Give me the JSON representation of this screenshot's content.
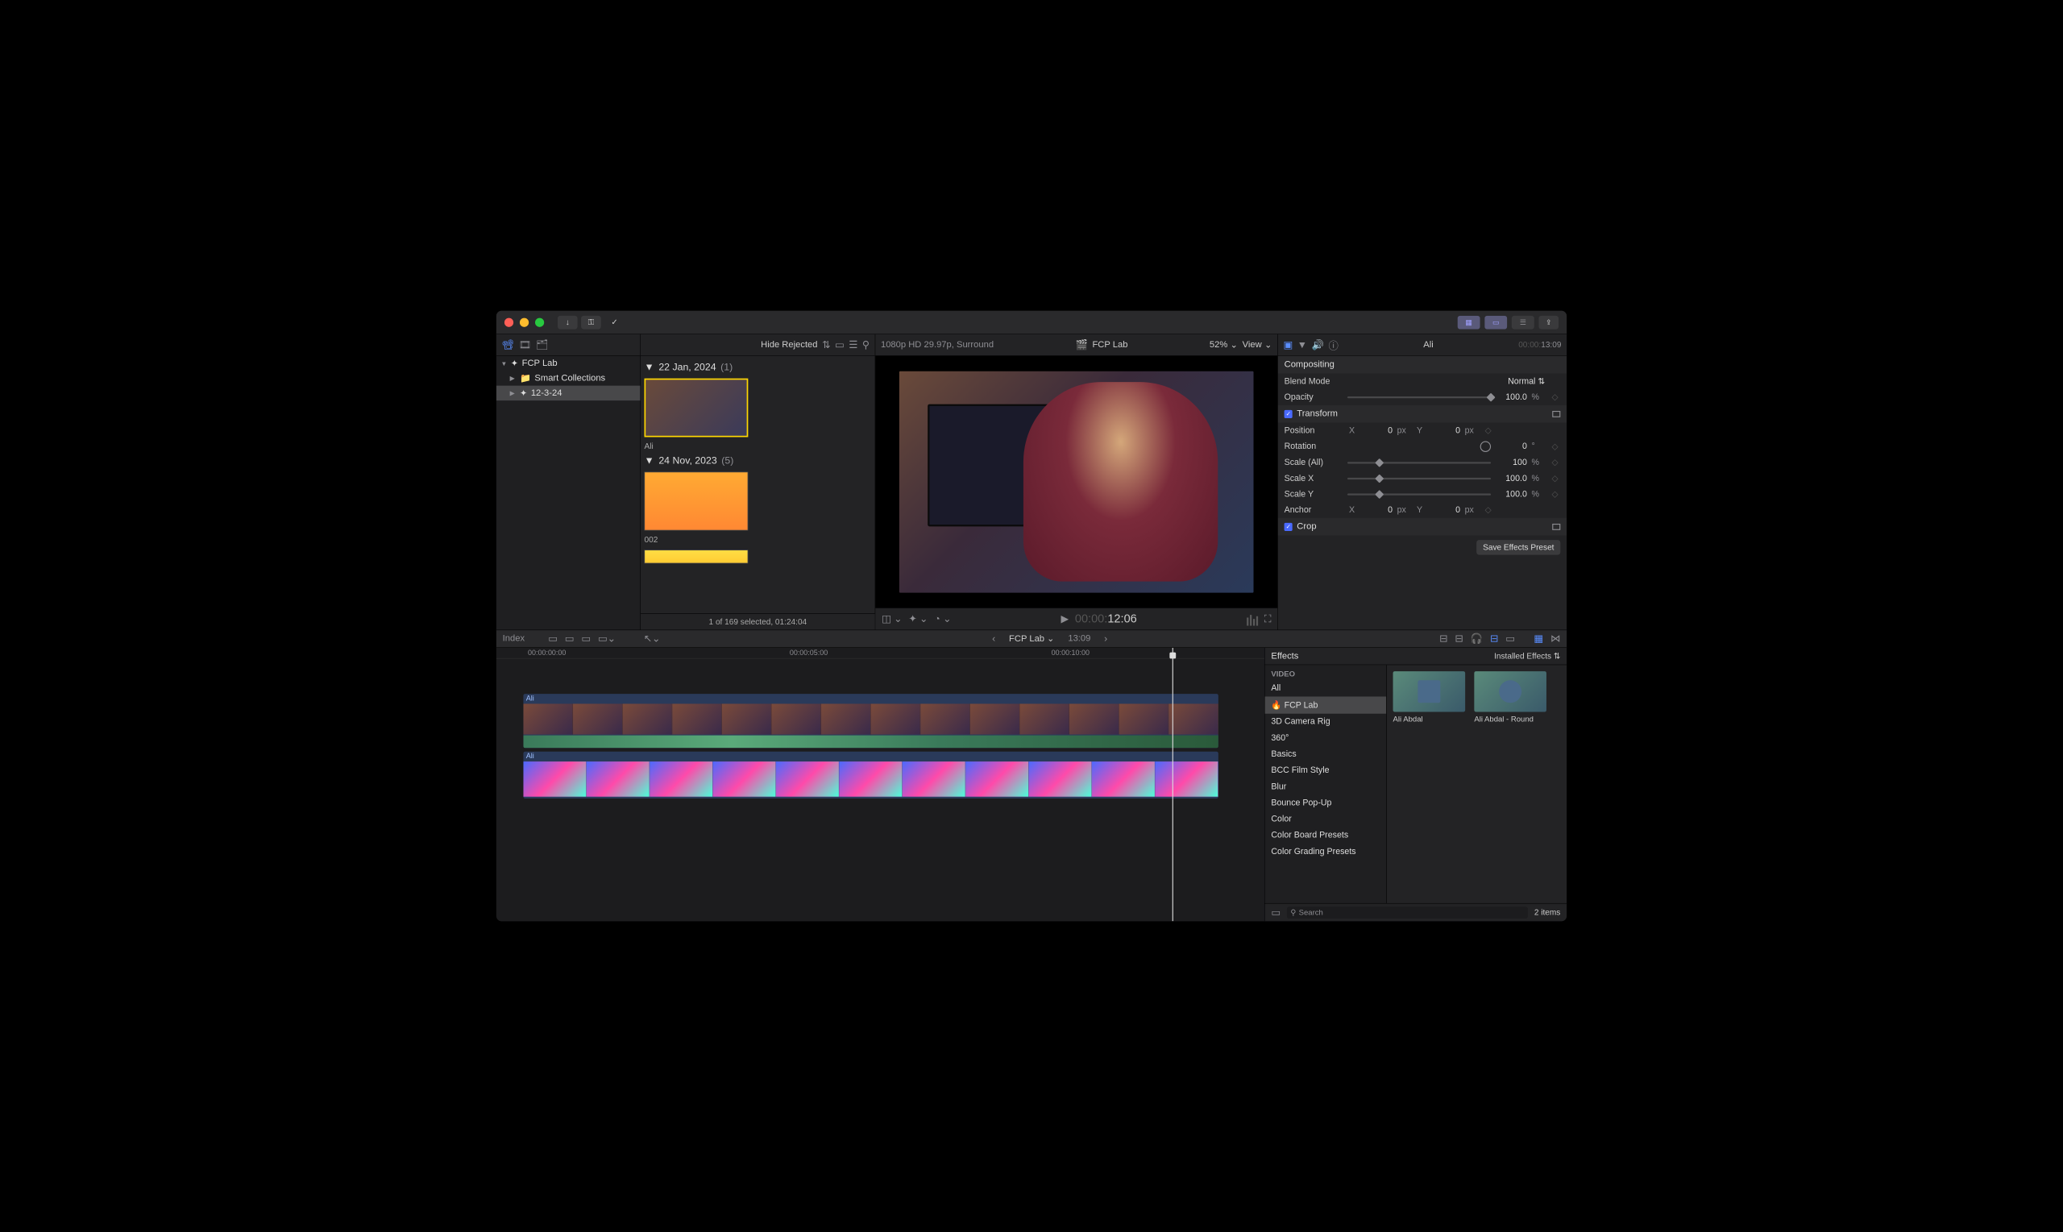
{
  "titlebar": {},
  "toolbar": {
    "hide_rejected": "Hide Rejected",
    "viewer_format": "1080p HD 29.97p, Surround",
    "project_name": "FCP Lab",
    "zoom": "52%",
    "view": "View"
  },
  "sidebar": {
    "library": "FCP Lab",
    "items": [
      {
        "label": "Smart Collections"
      },
      {
        "label": "12-3-24"
      }
    ]
  },
  "browser": {
    "events": [
      {
        "date": "22 Jan, 2024",
        "count": "(1)",
        "clips": [
          {
            "name": "Ali"
          }
        ]
      },
      {
        "date": "24 Nov, 2023",
        "count": "(5)",
        "clips": [
          {
            "name": "002"
          }
        ]
      }
    ],
    "footer": "1 of 169 selected, 01:24:04"
  },
  "viewer": {
    "timecode_dim": "00:00:",
    "timecode": "12:06"
  },
  "inspector": {
    "clip_name": "Ali",
    "duration_dim": "00:00:",
    "duration": "13:09",
    "compositing": "Compositing",
    "blend_mode_label": "Blend Mode",
    "blend_mode_value": "Normal",
    "opacity_label": "Opacity",
    "opacity_value": "100.0",
    "transform": "Transform",
    "position_label": "Position",
    "position_x": "0",
    "position_y": "0",
    "rotation_label": "Rotation",
    "rotation_value": "0",
    "scale_all_label": "Scale (All)",
    "scale_all_value": "100",
    "scale_x_label": "Scale X",
    "scale_x_value": "100.0",
    "scale_y_label": "Scale Y",
    "scale_y_value": "100.0",
    "anchor_label": "Anchor",
    "anchor_x": "0",
    "anchor_y": "0",
    "crop": "Crop",
    "save_preset": "Save Effects Preset",
    "px": "px",
    "pct": "%",
    "deg": "°",
    "x": "X",
    "y": "Y"
  },
  "timeline_toolbar": {
    "index": "Index",
    "project": "FCP Lab",
    "duration": "13:09"
  },
  "timeline": {
    "ruler": [
      {
        "pos": "70px",
        "label": "00:00:00:00"
      },
      {
        "pos": "650px",
        "label": "00:00:05:00"
      },
      {
        "pos": "1230px",
        "label": "00:00:10:00"
      }
    ],
    "clips": [
      {
        "name": "Ali"
      },
      {
        "name": "Ali"
      }
    ]
  },
  "effects": {
    "title": "Effects",
    "dropdown": "Installed Effects",
    "video_header": "VIDEO",
    "categories": [
      "All",
      "🔥 FCP Lab",
      "3D Camera Rig",
      "360°",
      "Basics",
      "BCC Film Style",
      "Blur",
      "Bounce Pop-Up",
      "Color",
      "Color Board Presets",
      "Color Grading Presets"
    ],
    "selected_index": 1,
    "items": [
      {
        "name": "Ali Abdal"
      },
      {
        "name": "Ali Abdal - Round"
      }
    ],
    "search_placeholder": "Search",
    "count": "2 items"
  }
}
